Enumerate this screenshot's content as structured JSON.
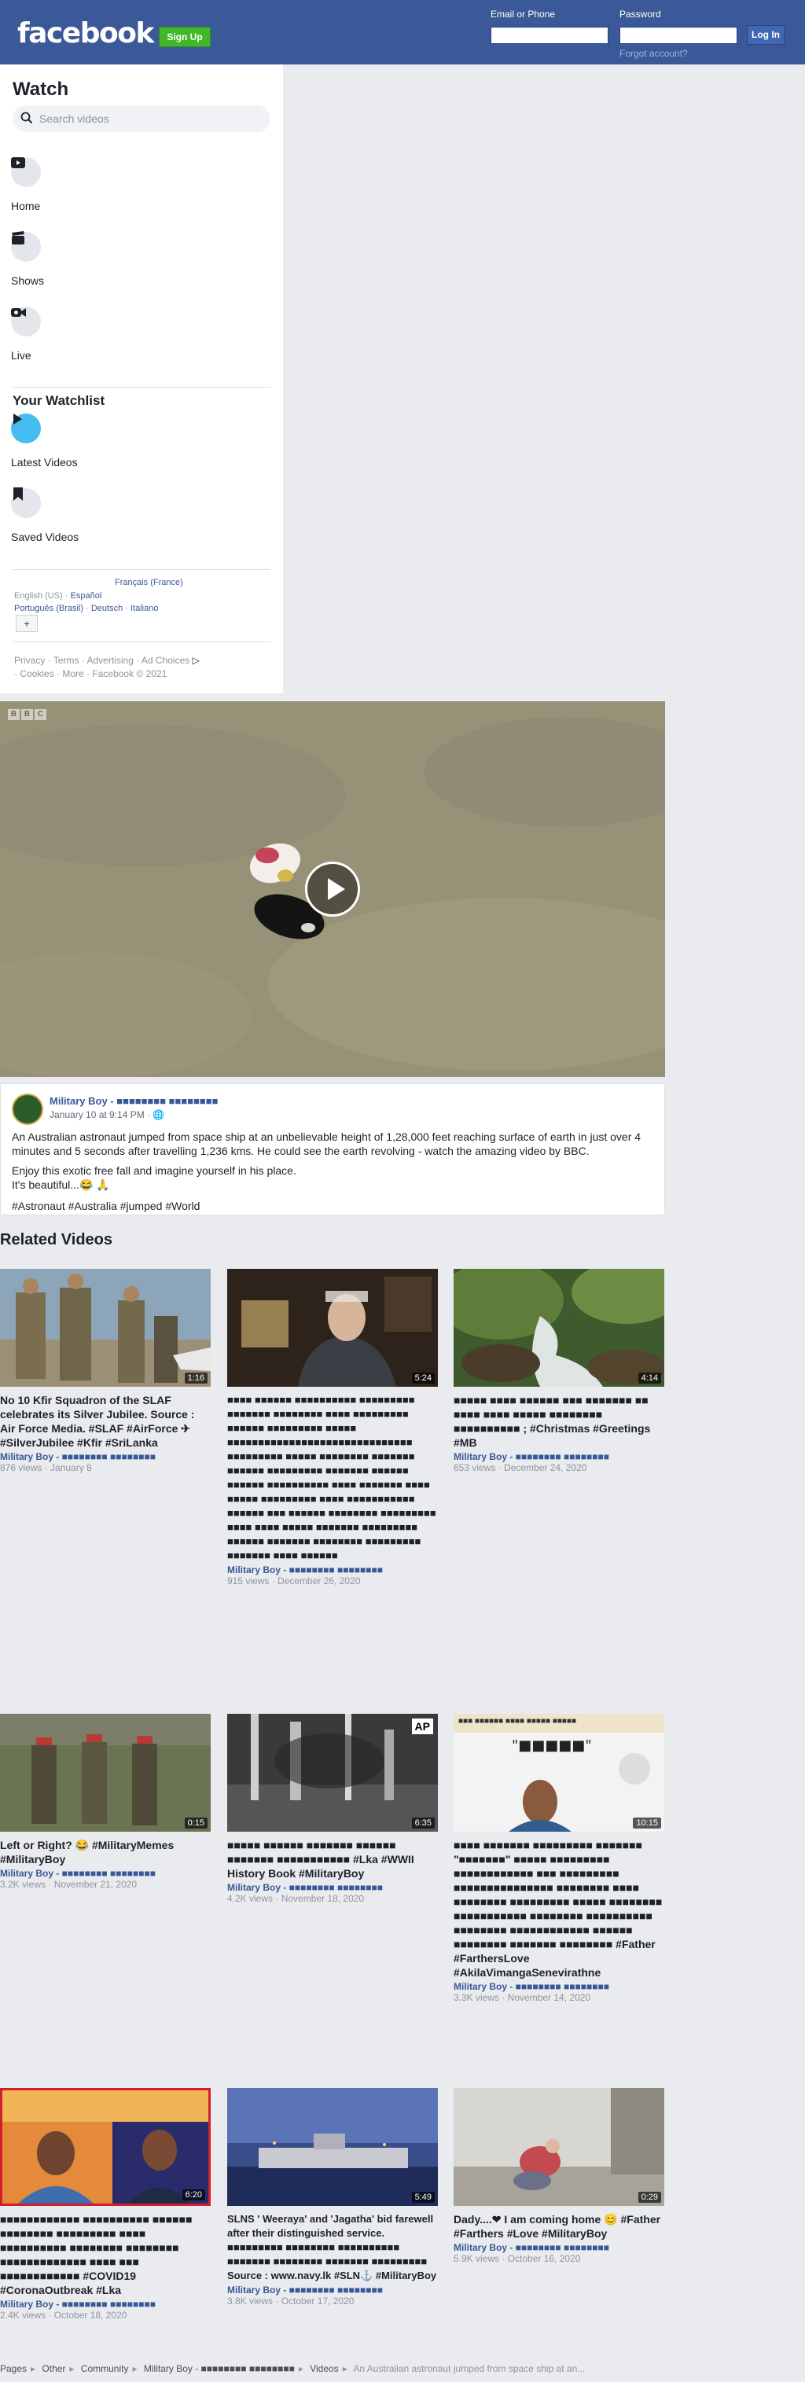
{
  "header": {
    "logo": "facebook",
    "signup": "Sign Up",
    "email_label": "Email or Phone",
    "password_label": "Password",
    "login": "Log In",
    "forgot": "Forgot account?"
  },
  "sidebar": {
    "title": "Watch",
    "search_placeholder": "Search videos",
    "items": [
      {
        "label": "Home"
      },
      {
        "label": "Shows"
      },
      {
        "label": "Live"
      }
    ],
    "watchlist_title": "Your Watchlist",
    "watchlist": [
      {
        "label": "Latest Videos"
      },
      {
        "label": "Saved Videos"
      }
    ],
    "languages": {
      "current": "English (US)",
      "l1": "Español",
      "l2": "Français (France)",
      "l3": "Português (Brasil)",
      "l4": "Deutsch",
      "l5": "Italiano"
    },
    "footer": {
      "privacy": "Privacy",
      "terms": "Terms",
      "advertising": "Advertising",
      "ad_choices": "Ad Choices",
      "cookies": "Cookies",
      "more": "More",
      "copyright": "Facebook © 2021"
    }
  },
  "video": {
    "watermark": [
      "B",
      "B",
      "C"
    ]
  },
  "post": {
    "author": "Military Boy - ■■■■■■■■ ■■■■■■■■",
    "date": "January 10 at 9:14 PM ·",
    "p1": "An Australian astronaut jumped from space ship at an unbelievable height of 1,28,000 feet reaching surface of earth in just over 4 minutes and 5 seconds after travelling 1,236 kms. He could see the earth revolving - watch the amazing video by BBC.",
    "p2": "Enjoy this exotic free fall and imagine yourself in his place.",
    "p3": "It's beautiful...😂 🙏",
    "p4": "#Astronaut #Australia #jumped #World"
  },
  "related_title": "Related Videos",
  "cards": [
    {
      "duration": "1:16",
      "title": "No 10 Kfir Squadron of the SLAF celebrates its Silver Jubilee. Source : Air Force Media. #SLAF #AirForce ✈ #SilverJubilee #Kfir #SriLanka",
      "author": "Military Boy - ■■■■■■■■ ■■■■■■■■",
      "meta": "876 views · January 8"
    },
    {
      "duration": "5:24",
      "title": "■■■■ ■■■■■■ ■■■■■■■■■■ ■■■■■■■■■ ■■■■■■■ ■■■■■■■■ ■■■■ ■■■■■■■■■ ■■■■■■ ■■■■■■■■■ ■■■■■ ■■■■■■■■■■■■■■■■■■■■■■■■■■■■■■ ■■■■■■■■■ ■■■■■ ■■■■■■■■ ■■■■■■■ ■■■■■■ ■■■■■■■■■ ■■■■■■■ ■■■■■■ ■■■■■■ ■■■■■■■■■■ ■■■■ ■■■■■■■ ■■■■ ■■■■■ ■■■■■■■■■ ■■■■ ■■■■■■■■■■■ ■■■■■■ ■■■ ■■■■■■ ■■■■■■■■ ■■■■■■■■■ ■■■■ ■■■■ ■■■■■ ■■■■■■■ ■■■■■■■■■ ■■■■■■ ■■■■■■■ ■■■■■■■■ ■■■■■■■■■ ■■■■■■■ ■■■■ ■■■■■■",
      "author": "Military Boy - ■■■■■■■■ ■■■■■■■■",
      "meta": "915 views · December 26, 2020"
    },
    {
      "duration": "4:14",
      "title": "■■■■■ ■■■■ ■■■■■■ ■■■ ■■■■■■■ ■■ ■■■■ ■■■■ ■■■■■ ■■■■■■■■ ■■■■■■■■■■ ; #Christmas #Greetings #MB",
      "author": "Military Boy - ■■■■■■■■ ■■■■■■■■",
      "meta": "653 views · December 24, 2020"
    },
    {
      "duration": "0:15",
      "title": "Left or Right? 😂 #MilitaryMemes #MilitaryBoy",
      "author": "Military Boy - ■■■■■■■■ ■■■■■■■■",
      "meta": "3.2K views · November 21, 2020"
    },
    {
      "duration": "6:35",
      "title": "■■■■■ ■■■■■■ ■■■■■■■ ■■■■■■ ■■■■■■■ ■■■■■■■■■■■ #Lka #WWII History Book #MilitaryBoy",
      "author": "Military Boy - ■■■■■■■■ ■■■■■■■■",
      "meta": "4.2K views · November 18, 2020"
    },
    {
      "duration": "10:15",
      "title": "■■■■ ■■■■■■■ ■■■■■■■■■ ■■■■■■■ \"■■■■■■■\" ■■■■■ ■■■■■■■■■ ■■■■■■■■■■■■ ■■■ ■■■■■■■■■ ■■■■■■■■■■■■■■■ ■■■■■■■■ ■■■■ ■■■■■■■■ ■■■■■■■■■ ■■■■■ ■■■■■■■■ ■■■■■■■■■■■ ■■■■■■■■ ■■■■■■■■■■ ■■■■■■■■ ■■■■■■■■■■■■ ■■■■■■ ■■■■■■■■ ■■■■■■■ ■■■■■■■■ #Father #FarthersLove #AkilaVimangaSenevirathne",
      "author": "Military Boy - ■■■■■■■■ ■■■■■■■■",
      "meta": "3.3K views · November 14, 2020"
    },
    {
      "duration": "6:20",
      "title": "■■■■■■■■■■■■ ■■■■■■■■■■ ■■■■■■ ■■■■■■■■ ■■■■■■■■■ ■■■■ ■■■■■■■■■■ ■■■■■■■■ ■■■■■■■■ ■■■■■■■■■■■■■ ■■■■ ■■■ ■■■■■■■■■■■■ #COVID19 #CoronaOutbreak #Lka",
      "author": "Military Boy - ■■■■■■■■ ■■■■■■■■",
      "meta": "2.4K views · October 18, 2020"
    },
    {
      "duration": "5:49",
      "title": "SLNS ' Weeraya' and 'Jagatha' bid farewell after their distinguished service. ■■■■■■■■■ ■■■■■■■■ ■■■■■■■■■■ ■■■■■■■ ■■■■■■■■ ■■■■■■■ ■■■■■■■■■ Source : www.navy.lk #SLN⚓ #MilitaryBoy",
      "author": "Military Boy - ■■■■■■■■ ■■■■■■■■",
      "meta": "3.8K views · October 17, 2020"
    },
    {
      "duration": "0:29",
      "title": "Dady....❤ I am coming home 😊 #Father #Farthers #Love #MilitaryBoy",
      "author": "Military Boy - ■■■■■■■■ ■■■■■■■■",
      "meta": "5.9K views · October 16, 2020"
    }
  ],
  "thumb_texts": {
    "ap": "AP",
    "sinhala_top": "■■■ ■■■■■■ ■■■■ ■■■■■ ■■■■■",
    "sinhala_quote": "\"■■■■■\""
  },
  "breadcrumb": {
    "pages": "Pages",
    "other": "Other",
    "community": "Community",
    "page": "Military Boy - ■■■■■■■■ ■■■■■■■■",
    "videos": "Videos",
    "current": "An Australian astronaut jumped from space ship at an..."
  }
}
